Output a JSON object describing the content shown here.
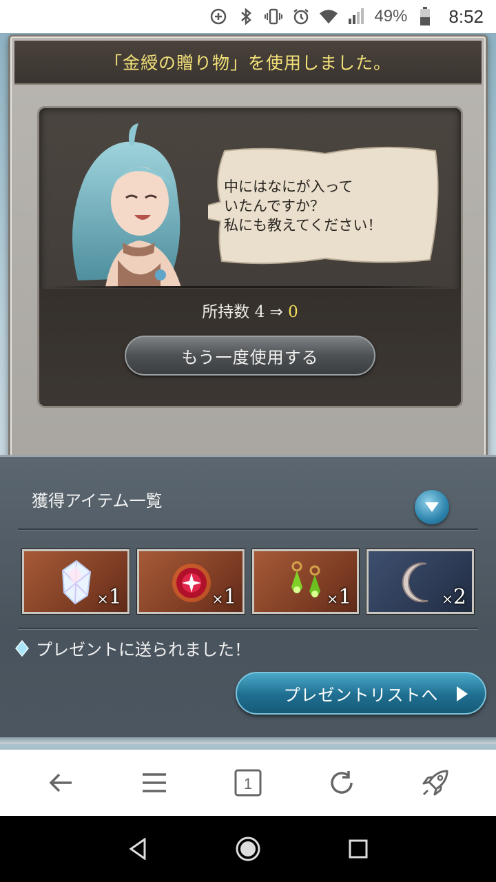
{
  "status_bar": {
    "battery_percent": "49%",
    "time": "8:52",
    "icons": [
      "data-saver-icon",
      "bluetooth-icon",
      "vibrate-icon",
      "alarm-icon",
      "wifi-icon",
      "signal-icon",
      "battery-icon"
    ]
  },
  "dialog": {
    "title": "「金綬の贈り物」を使用しました。",
    "speech": "中にはなにが入って\nいたんですか？\n私にも教えてください！",
    "count_label": "所持数",
    "count_before": "4",
    "count_arrow": "⇒",
    "count_after": "0",
    "reuse_button": "もう一度使用する"
  },
  "items": {
    "title": "獲得アイテム一覧",
    "list": [
      {
        "icon": "crystal-icon",
        "qty": "1",
        "style": "brown"
      },
      {
        "icon": "red-orb-icon",
        "qty": "1",
        "style": "brown"
      },
      {
        "icon": "green-earrings-icon",
        "qty": "1",
        "style": "brown"
      },
      {
        "icon": "silver-moon-icon",
        "qty": "2",
        "style": "dark"
      }
    ],
    "qty_prefix": "×",
    "sent_message": "プレゼントに送られました！",
    "present_button": "プレゼントリストへ"
  },
  "browser_toolbar": {
    "tab_count": "1",
    "buttons": [
      "back-icon",
      "menu-icon",
      "tabs-icon",
      "reload-icon",
      "rocket-icon"
    ]
  },
  "colors": {
    "title_yellow": "#f3e179",
    "count_highlight": "#f4e15c",
    "present_button_blue": "#1f6e90"
  }
}
